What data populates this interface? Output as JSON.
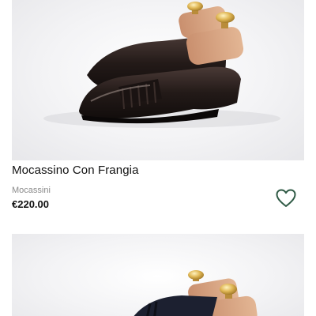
{
  "products": [
    {
      "title": "Mocassino Con Frangia",
      "category": "Mocassini",
      "price": "€220.00",
      "wishlist_icon": "heart-outline-icon",
      "accent_color": "#2f5a45"
    },
    {
      "image_only": true
    }
  ]
}
